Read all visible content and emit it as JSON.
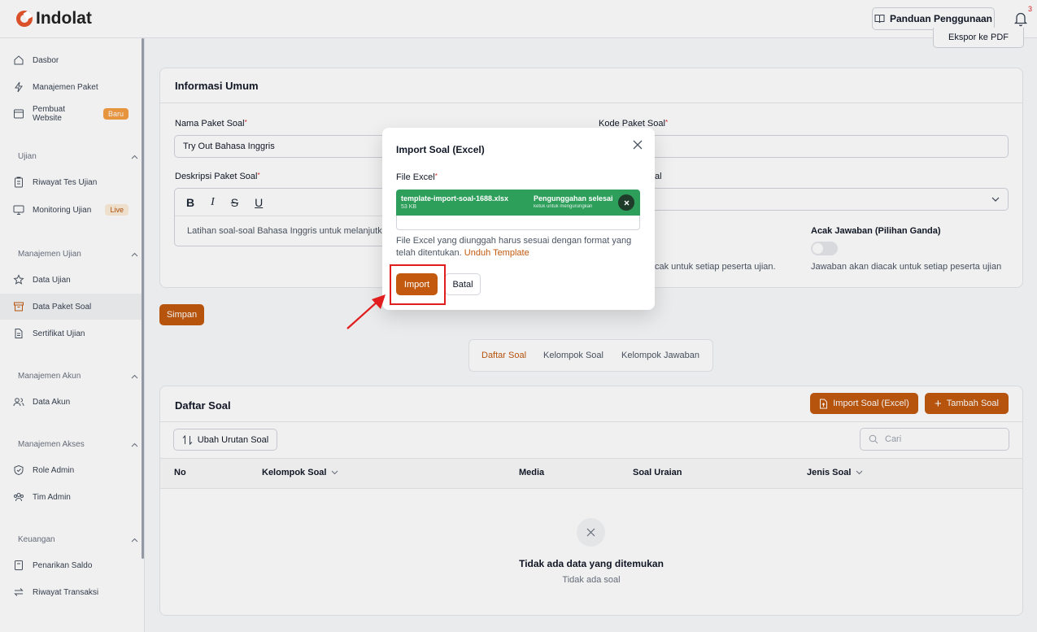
{
  "header": {
    "brand": "Indolat",
    "guide_label": "Panduan Penggunaan",
    "notif_count": "3"
  },
  "sidebar": {
    "items_top": [
      {
        "label": "Dasbor"
      },
      {
        "label": "Manajemen Paket"
      },
      {
        "label": "Pembuat Website",
        "badge": "Baru"
      }
    ],
    "sections": [
      {
        "title": "Ujian",
        "items": [
          {
            "label": "Riwayat Tes Ujian"
          },
          {
            "label": "Monitoring Ujian",
            "badge": "Live"
          }
        ]
      },
      {
        "title": "Manajemen Ujian",
        "items": [
          {
            "label": "Data Ujian"
          },
          {
            "label": "Data Paket Soal"
          },
          {
            "label": "Sertifikat Ujian"
          }
        ]
      },
      {
        "title": "Manajemen Akun",
        "items": [
          {
            "label": "Data Akun"
          }
        ]
      },
      {
        "title": "Manajemen Akses",
        "items": [
          {
            "label": "Role Admin"
          },
          {
            "label": "Tim Admin"
          }
        ]
      },
      {
        "title": "Keuangan",
        "items": [
          {
            "label": "Penarikan Saldo"
          },
          {
            "label": "Riwayat Transaksi"
          }
        ]
      }
    ]
  },
  "info": {
    "title": "Informasi Umum",
    "export_label": "Ekspor ke PDF",
    "name_label": "Nama Paket Soal",
    "name_value": "Try Out Bahasa Inggris",
    "code_label": "Kode Paket Soal",
    "desc_label": "Deskripsi Paket Soal",
    "desc_value": "Latihan soal-soal Bahasa Inggris untuk melanjutkan",
    "select_label_partial": "al",
    "shuffle_q_help_partial": "cak untuk setiap peserta ujian.",
    "shuffle_a_label": "Acak Jawaban (Pilihan Ganda)",
    "shuffle_a_help": "Jawaban akan diacak untuk setiap peserta ujian",
    "save_label": "Simpan"
  },
  "tabs": [
    {
      "label": "Daftar Soal"
    },
    {
      "label": "Kelompok Soal"
    },
    {
      "label": "Kelompok Jawaban"
    }
  ],
  "list": {
    "title": "Daftar Soal",
    "import_label": "Import Soal (Excel)",
    "add_label": "Tambah Soal",
    "reorder_label": "Ubah Urutan Soal",
    "search_placeholder": "Cari",
    "columns": [
      "No",
      "Kelompok Soal",
      "Media",
      "Soal Uraian",
      "Jenis Soal"
    ],
    "empty_title": "Tidak ada data yang ditemukan",
    "empty_sub": "Tidak ada soal"
  },
  "modal": {
    "title": "Import Soal (Excel)",
    "file_label": "File Excel",
    "file_name": "template-import-soal-1688.xlsx",
    "file_size": "53 KB",
    "upload_status": "Pengunggahan selesai",
    "upload_hint": "ketuk untuk mengurungkan",
    "help_text": "File Excel yang diunggah harus sesuai dengan format yang telah ditentukan.",
    "template_link": "Unduh Template",
    "import_label": "Import",
    "cancel_label": "Batal"
  },
  "colors": {
    "accent": "#c2590e",
    "success": "#2e9e5b",
    "annotation": "#e11d1d"
  }
}
